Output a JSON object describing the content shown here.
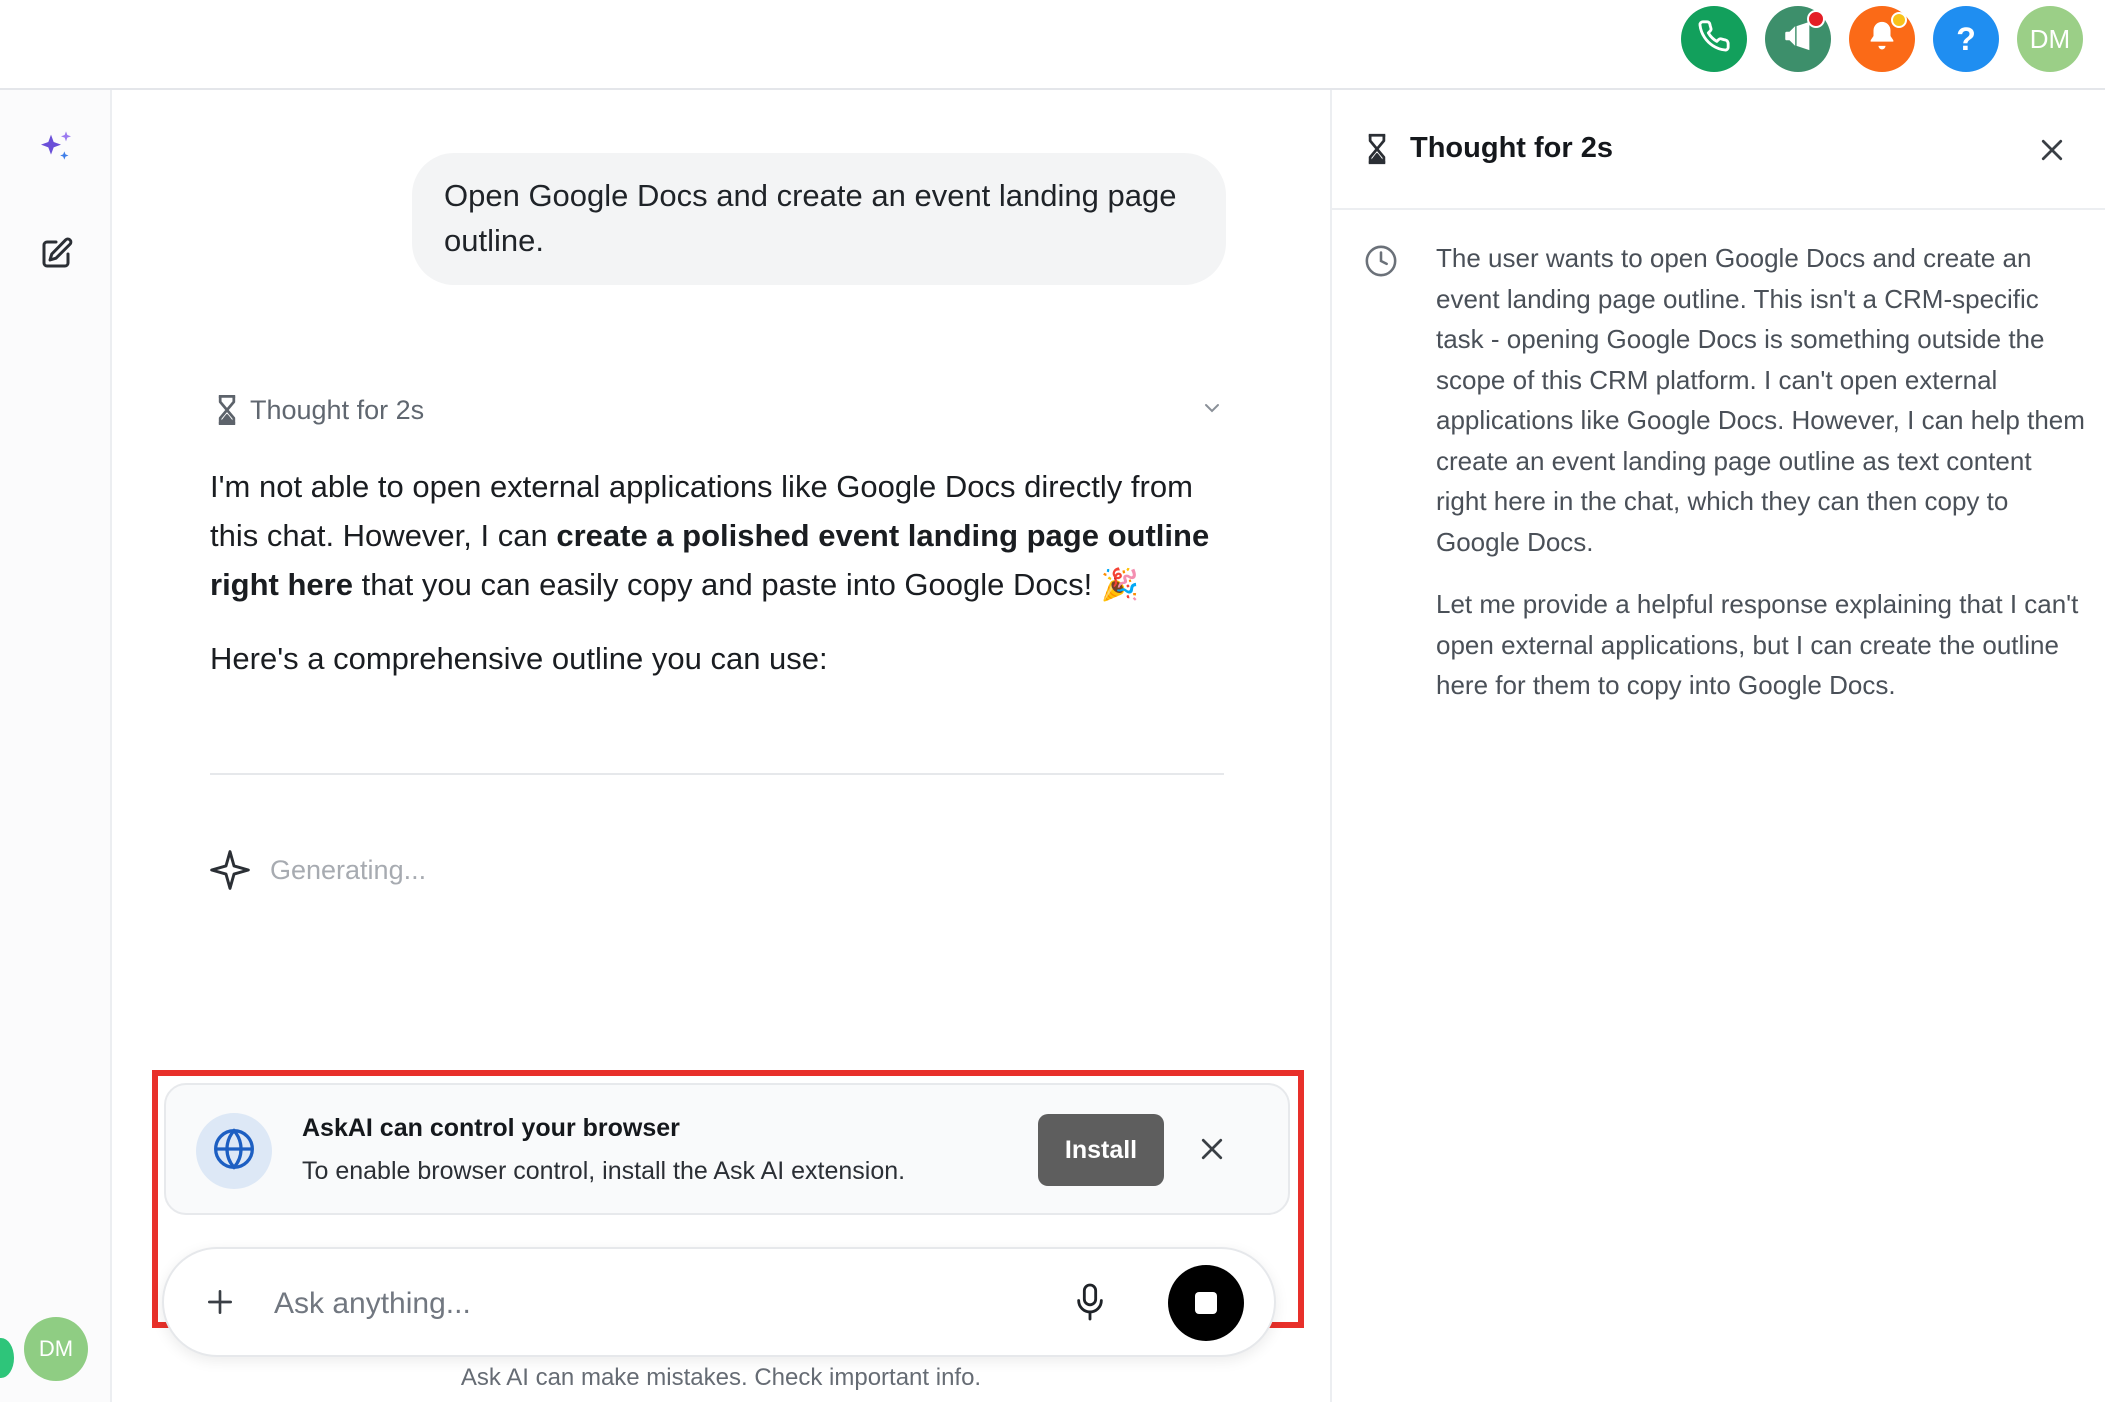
{
  "header": {
    "actions": [
      {
        "name": "phone",
        "icon": "phone-icon"
      },
      {
        "name": "announcements",
        "icon": "megaphone-icon"
      },
      {
        "name": "notifications",
        "icon": "bell-icon"
      },
      {
        "name": "help",
        "icon": "question-icon",
        "label": "?"
      },
      {
        "name": "profile",
        "icon": "avatar",
        "label": "DM"
      }
    ]
  },
  "sidebar": {
    "items": [
      {
        "name": "ai-sparkle",
        "icon": "sparkle-icon"
      },
      {
        "name": "new-chat",
        "icon": "compose-icon"
      }
    ],
    "avatar_initials": "DM"
  },
  "conversation": {
    "user_message": "Open Google Docs and create an event landing page outline.",
    "thought_label": "Thought for 2s",
    "response": {
      "p1_start": "I'm not able to open external applications like Google Docs directly from this chat. However, I can ",
      "p1_bold": "create a polished event landing page outline right here",
      "p1_end": " that you can easily copy and paste into Google Docs! 🎉",
      "p2": "Here's a comprehensive outline you can use:"
    },
    "generating_label": "Generating..."
  },
  "extension_banner": {
    "title": "AskAI can control your browser",
    "subtitle": "To enable browser control, install the Ask AI extension.",
    "install_label": "Install"
  },
  "composer": {
    "placeholder": "Ask anything...",
    "disclaimer": "Ask AI can make mistakes. Check important info."
  },
  "thought_panel": {
    "title": "Thought for 2s",
    "paragraphs": [
      "The user wants to open Google Docs and create an event landing page outline. This isn't a CRM-specific task - opening Google Docs is something outside the scope of this CRM platform. I can't open external applications like Google Docs. However, I can help them create an event landing page outline as text content right here in the chat, which they can then copy to Google Docs.",
      "Let me provide a helpful response explaining that I can't open external applications, but I can create the outline here for them to copy into Google Docs."
    ]
  },
  "colors": {
    "highlight_border": "#e8302a",
    "phone_green": "#12a05c",
    "bell_orange": "#fb6a17",
    "help_blue": "#1f8ef1",
    "install_button": "#5e5e5e"
  }
}
